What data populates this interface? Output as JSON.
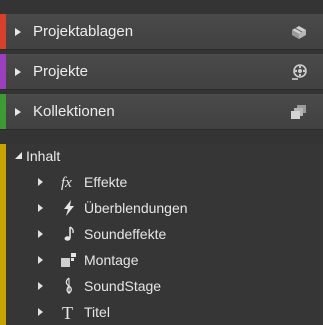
{
  "panel": {
    "sections": [
      {
        "label": "Projektablagen",
        "icon": "bins-icon",
        "color": "#d8402c"
      },
      {
        "label": "Projekte",
        "icon": "projects-icon",
        "color": "#9b3fbf"
      },
      {
        "label": "Kollektionen",
        "icon": "collections-icon",
        "color": "#3d9a34"
      }
    ],
    "inhalt": {
      "label": "Inhalt",
      "color": "#c9a400",
      "items": [
        {
          "label": "Effekte",
          "icon": "fx-icon"
        },
        {
          "label": "Überblendungen",
          "icon": "lightning-icon"
        },
        {
          "label": "Soundeffekte",
          "icon": "music-note-icon"
        },
        {
          "label": "Montage",
          "icon": "montage-icon"
        },
        {
          "label": "SoundStage",
          "icon": "soundstage-icon"
        },
        {
          "label": "Titel",
          "icon": "title-t-icon"
        }
      ]
    }
  }
}
